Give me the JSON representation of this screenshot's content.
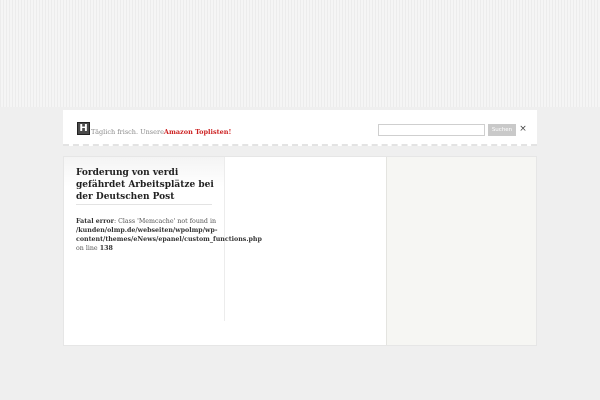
{
  "header": {
    "logo_glyph": "H",
    "tagline_text": "Täglich frisch. Unsere",
    "tagline_link": "Amazon Toplisten!",
    "search": {
      "value": "",
      "placeholder": "",
      "button_label": "Suchen"
    },
    "close_glyph": "×"
  },
  "post": {
    "title": "Forderung von verdi gefährdet Arbeitsplätze bei der Deutschen Post",
    "error": {
      "label": "Fatal error",
      "message": ": Class 'Memcache' not found in",
      "path": "/kunden/olmp.de/webseiten/wpolmp/wp-content/themes/eNews/epanel/custom_functions.php",
      "line_prefix": "on line",
      "line_number": "138"
    }
  },
  "colors": {
    "page_background": "#efefef",
    "link_red": "#cc1f1f",
    "sidebar_background": "#f6f6f3"
  }
}
